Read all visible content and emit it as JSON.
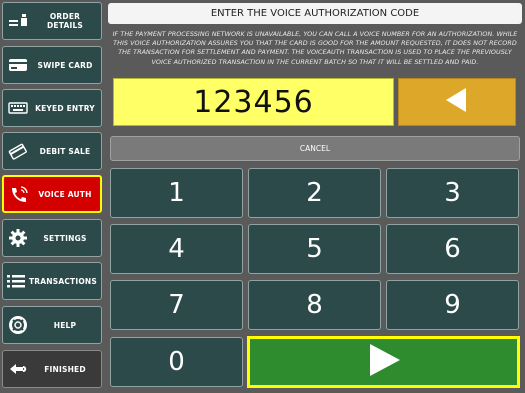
{
  "sidebar": {
    "items": [
      {
        "label": "ORDER DETAILS",
        "icon": "order-details-icon"
      },
      {
        "label": "SWIPE CARD",
        "icon": "credit-card-icon"
      },
      {
        "label": "KEYED ENTRY",
        "icon": "keyboard-icon"
      },
      {
        "label": "DEBIT SALE",
        "icon": "debit-card-icon"
      },
      {
        "label": "VOICE AUTH",
        "icon": "phone-icon",
        "active": true
      },
      {
        "label": "SETTINGS",
        "icon": "gear-icon"
      },
      {
        "label": "TRANSACTIONS",
        "icon": "list-icon"
      },
      {
        "label": "HELP",
        "icon": "lifebuoy-icon"
      },
      {
        "label": "FINISHED",
        "icon": "return-arrow-icon"
      }
    ]
  },
  "main": {
    "title": "ENTER THE VOICE AUTHORIZATION CODE",
    "notice": "IF THE PAYMENT PROCESSING NETWORK IS UNAVAILABLE, YOU CAN CALL A VOICE NUMBER FOR AN AUTHORIZATION. WHILE THIS VOICE AUTHORIZATION ASSURES YOU THAT THE CARD IS GOOD FOR THE AMOUNT REQUESTED, IT DOES NOT RECORD THE TRANSACTION FOR SETTLEMENT AND PAYMENT. THE VOICEAUTH TRANSACTION IS USED TO PLACE THE PREVIOUSLY VOICE AUTHORIZED TRANSACTION IN THE CURRENT BATCH SO THAT IT WILL BE SETTLED AND PAID.",
    "code_value": "123456",
    "cancel_label": "CANCEL",
    "keys": [
      "1",
      "2",
      "3",
      "4",
      "5",
      "6",
      "7",
      "8",
      "9",
      "0"
    ]
  },
  "colors": {
    "key_bg": "#2d4a4a",
    "active_bg": "#d40000",
    "highlight_border": "#ffff00",
    "display_bg": "#ffff66",
    "backspace_bg": "#dda829",
    "enter_bg": "#2e8b2e"
  }
}
